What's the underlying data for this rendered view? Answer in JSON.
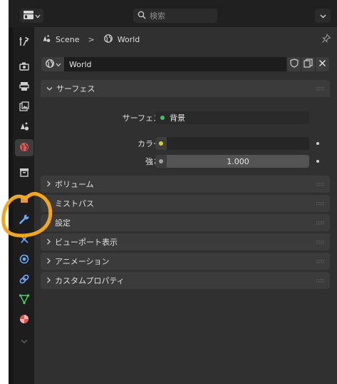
{
  "header": {
    "search_placeholder": "検索"
  },
  "breadcrumb": {
    "scene": "Scene",
    "separator": ">",
    "world": "World"
  },
  "datablock": {
    "name": "World"
  },
  "surface_panel": {
    "title": "サーフェス",
    "surface_label": "サーフェス",
    "surface_value": "背景",
    "color_label": "カラー",
    "strength_label": "強さ",
    "strength_value": "1.000"
  },
  "panels": {
    "volume": "ボリューム",
    "mist_pass": "ミストパス",
    "settings": "設定",
    "viewport_display": "ビューポート表示",
    "animation": "アニメーション",
    "custom_properties": "カスタムプロパティ"
  },
  "colors": {
    "accent_orange": "#f5a71b",
    "surface_dot": "#3ec35d",
    "color_dot": "#d8d02c",
    "world_icon": "#e05555"
  },
  "icons": [
    "editor-type-icon",
    "search-icon",
    "options-icon",
    "tool-icon",
    "render-icon",
    "output-icon",
    "view-layer-icon",
    "scene-icon",
    "world-icon",
    "collection-icon",
    "object-icon",
    "modifier-icon",
    "particles-icon",
    "physics-icon",
    "constraints-icon",
    "data-icon",
    "material-icon",
    "pin-icon",
    "fake-user-icon",
    "duplicate-icon",
    "unlink-icon"
  ]
}
